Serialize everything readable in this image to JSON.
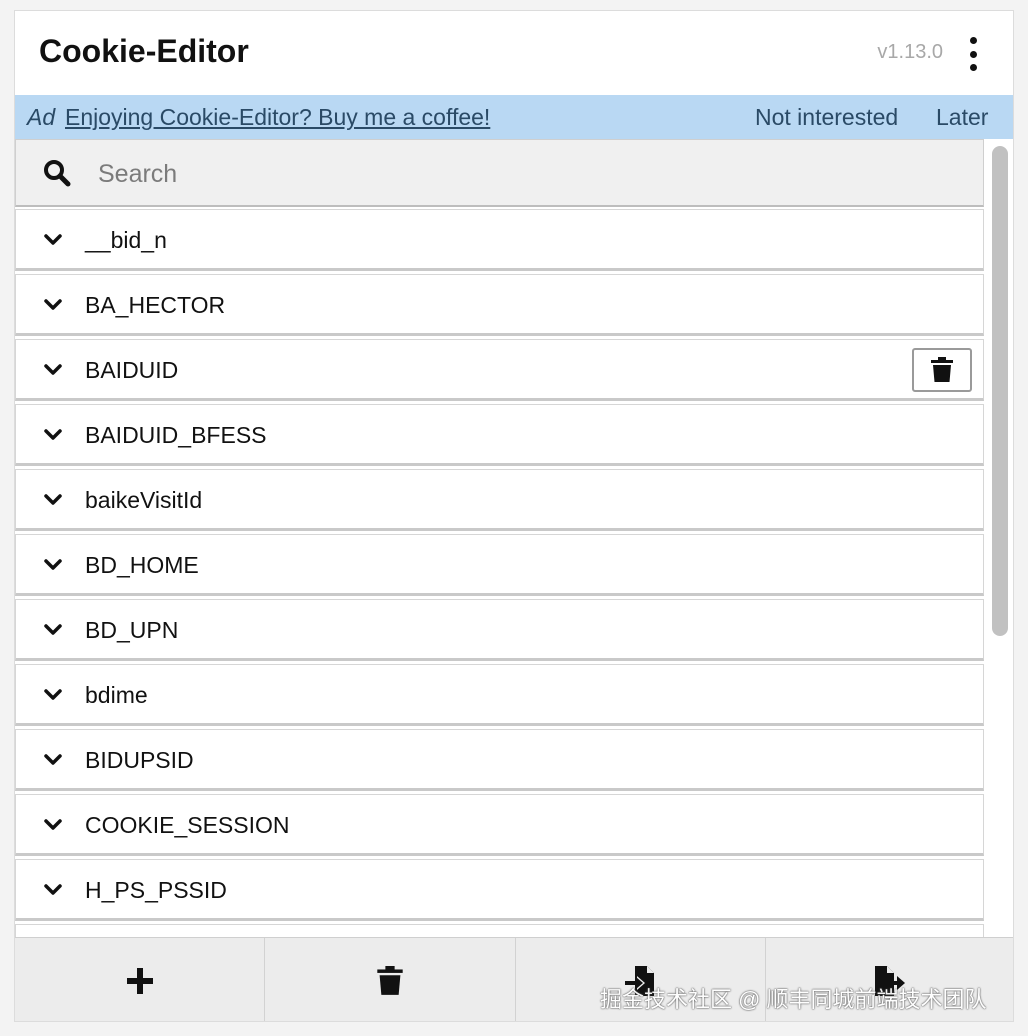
{
  "header": {
    "title": "Cookie-Editor",
    "version": "v1.13.0"
  },
  "ad": {
    "label": "Ad",
    "link_text": "Enjoying Cookie-Editor? Buy me a coffee!",
    "not_interested": "Not interested",
    "later": "Later"
  },
  "search": {
    "placeholder": "Search",
    "value": ""
  },
  "cookies": [
    {
      "name": "__bid_n"
    },
    {
      "name": "BA_HECTOR"
    },
    {
      "name": "BAIDUID"
    },
    {
      "name": "BAIDUID_BFESS"
    },
    {
      "name": "baikeVisitId"
    },
    {
      "name": "BD_HOME"
    },
    {
      "name": "BD_UPN"
    },
    {
      "name": "bdime"
    },
    {
      "name": "BIDUPSID"
    },
    {
      "name": "COOKIE_SESSION"
    },
    {
      "name": "H_PS_PSSID"
    },
    {
      "name": ""
    }
  ],
  "footer": {
    "buttons": [
      "add-icon",
      "delete-all-icon",
      "import-icon",
      "export-icon"
    ]
  },
  "watermark": "掘金技术社区 @ 顺丰同城前端技术团队",
  "colors": {
    "ad_background": "#b9d8f3",
    "ad_text": "#2a4a66",
    "version_text": "#a8a8a8"
  }
}
